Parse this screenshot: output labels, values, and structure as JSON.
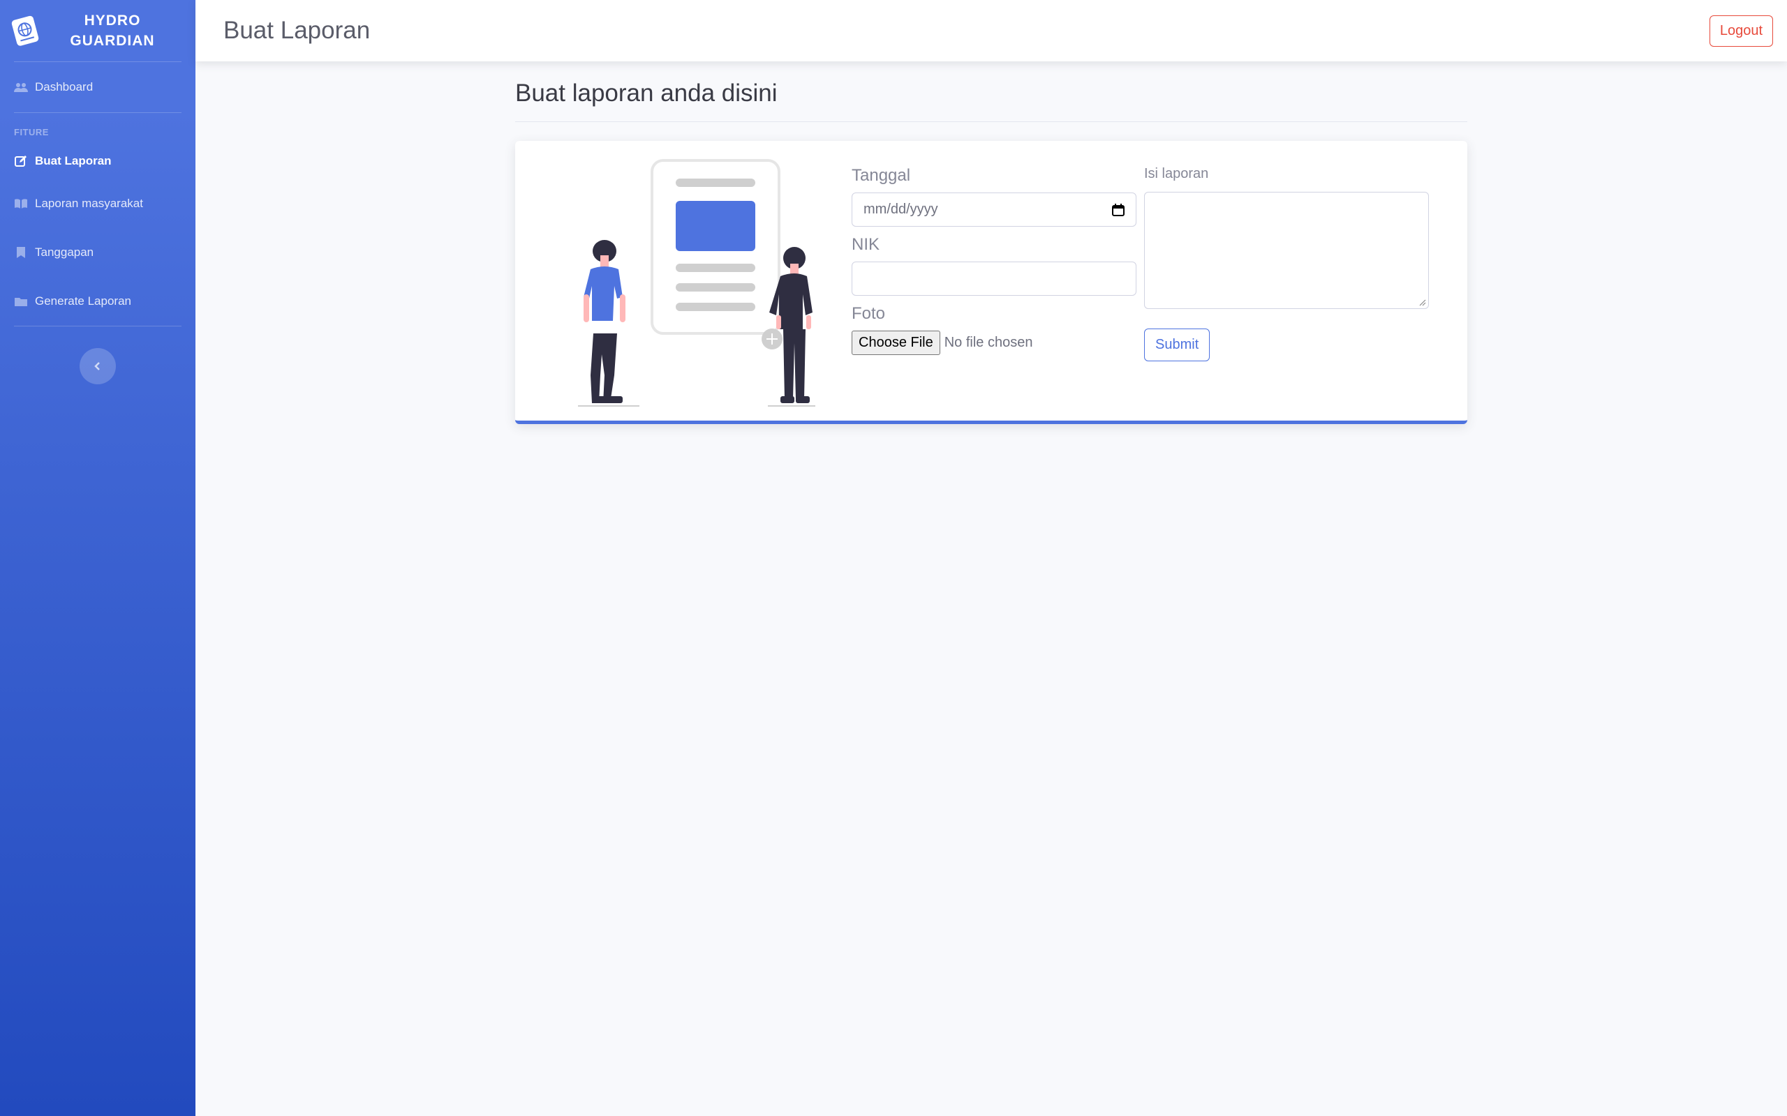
{
  "sidebar": {
    "brand": "HYDRO GUARDIAN",
    "items": [
      {
        "label": "Dashboard",
        "icon": "users-icon"
      },
      {
        "label": "Buat Laporan",
        "icon": "edit-icon",
        "active": true
      },
      {
        "label": "Laporan masyarakat",
        "icon": "book-icon"
      },
      {
        "label": "Tanggapan",
        "icon": "bookmark-icon"
      },
      {
        "label": "Generate Laporan",
        "icon": "folder-icon"
      }
    ],
    "section_heading": "FITURE"
  },
  "topbar": {
    "title": "Buat Laporan",
    "logout_label": "Logout"
  },
  "main": {
    "heading": "Buat laporan anda disini",
    "form": {
      "tanggal_label": "Tanggal",
      "tanggal_placeholder": "mm/dd/yyyy",
      "nik_label": "NIK",
      "nik_value": "",
      "foto_label": "Foto",
      "file_button": "Choose File",
      "file_status": "No file chosen",
      "isi_label": "Isi laporan",
      "isi_value": "",
      "submit_label": "Submit"
    }
  },
  "colors": {
    "primary": "#4e73df",
    "danger": "#e74a3b",
    "background": "#f8f9fc"
  }
}
